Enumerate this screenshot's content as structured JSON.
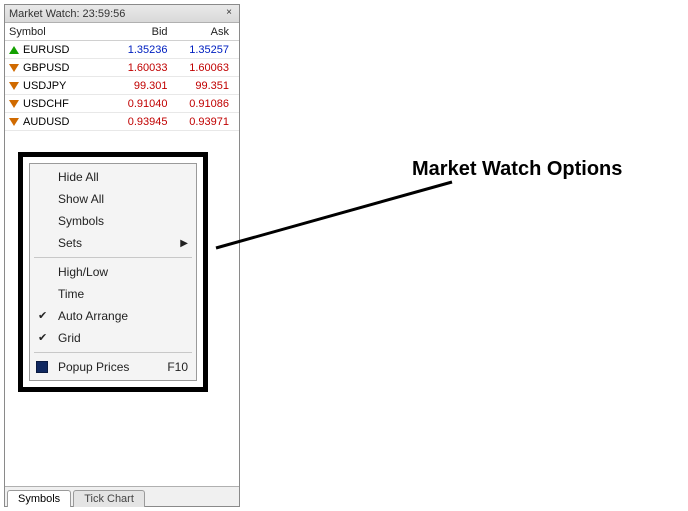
{
  "panel": {
    "title": "Market Watch: 23:59:56",
    "close_glyph": "×"
  },
  "columns": {
    "symbol": "Symbol",
    "bid": "Bid",
    "ask": "Ask"
  },
  "rows": [
    {
      "dir": "up",
      "symbol": "EURUSD",
      "bid": "1.35236",
      "ask": "1.35257",
      "cls": "price-up"
    },
    {
      "dir": "down",
      "symbol": "GBPUSD",
      "bid": "1.60033",
      "ask": "1.60063",
      "cls": "price-down"
    },
    {
      "dir": "down",
      "symbol": "USDJPY",
      "bid": "99.301",
      "ask": "99.351",
      "cls": "price-down"
    },
    {
      "dir": "down",
      "symbol": "USDCHF",
      "bid": "0.91040",
      "ask": "0.91086",
      "cls": "price-down"
    },
    {
      "dir": "down",
      "symbol": "AUDUSD",
      "bid": "0.93945",
      "ask": "0.93971",
      "cls": "price-down"
    }
  ],
  "context_menu": {
    "hide_all": "Hide All",
    "show_all": "Show All",
    "symbols": "Symbols",
    "sets": "Sets",
    "high_low": "High/Low",
    "time": "Time",
    "auto_arrange": "Auto Arrange",
    "grid": "Grid",
    "popup_prices": "Popup Prices",
    "popup_shortcut": "F10",
    "checkmark": "✔",
    "submenu_arrow": "▶"
  },
  "tabs": {
    "symbols": "Symbols",
    "tick_chart": "Tick Chart"
  },
  "annotation": {
    "label": "Market Watch Options"
  }
}
